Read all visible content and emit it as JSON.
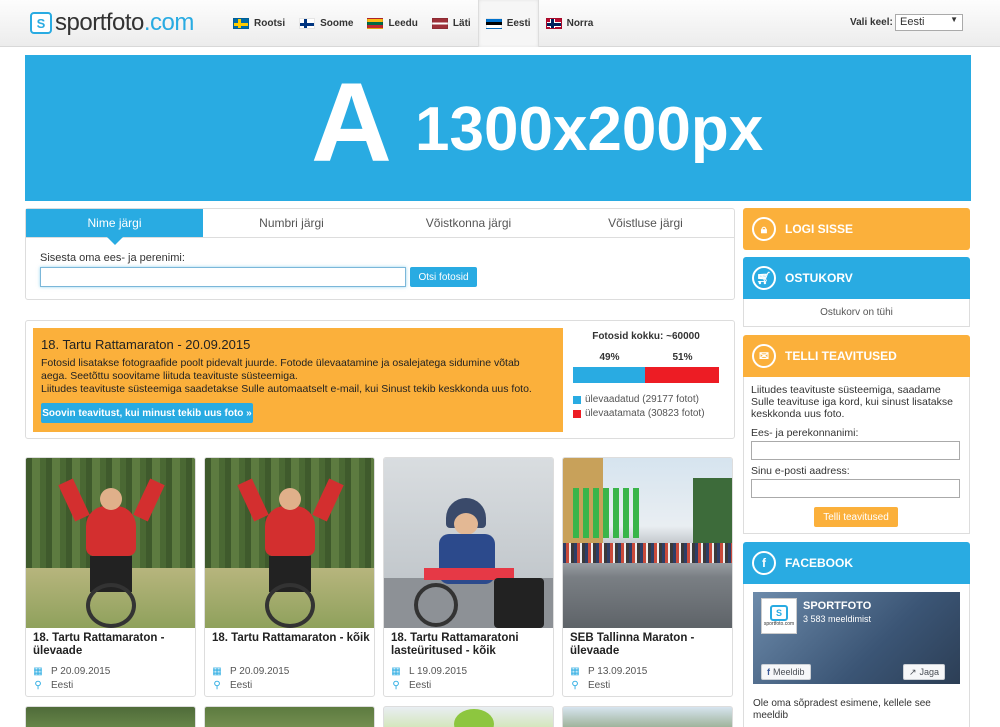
{
  "header": {
    "logo_brand": "sportfoto",
    "logo_tld": ".com",
    "logo_icon_letter": "S",
    "languages": [
      {
        "label": "Rootsi",
        "flag": "sweden-flag"
      },
      {
        "label": "Soome",
        "flag": "finland-flag"
      },
      {
        "label": "Leedu",
        "flag": "lithuania-flag"
      },
      {
        "label": "Läti",
        "flag": "latvia-flag"
      },
      {
        "label": "Eesti",
        "flag": "estonia-flag",
        "active": true
      },
      {
        "label": "Norra",
        "flag": "norway-flag"
      }
    ],
    "language_label": "Vali keel:",
    "language_selected": "Eesti"
  },
  "banner": {
    "letter": "A",
    "size_text": "1300x200px"
  },
  "search": {
    "tabs": [
      "Nime järgi",
      "Numbri järgi",
      "Võistkonna järgi",
      "Võistluse järgi"
    ],
    "active_tab": 0,
    "label": "Sisesta oma ees- ja perenimi:",
    "input_value": "",
    "button": "Otsi fotosid"
  },
  "event": {
    "title": "18. Tartu Rattamaraton - 20.09.2015",
    "description_lines": [
      "Fotosid lisatakse fotograafide poolt pidevalt juurde. Fotode ülevaatamine ja osalejatega sidumine võtab",
      "aega. Seetõttu soovitame liituda teavituste süsteemiga.",
      "Liitudes teavituste süsteemiga saadetakse Sulle automaatselt e-mail, kui Sinust tekib keskkonda uus foto."
    ],
    "button": "Soovin teavitust, kui minust tekib uus foto »",
    "stats": {
      "title": "Fotosid kokku: ~60000",
      "reviewed_pct_label": "49%",
      "unreviewed_pct_label": "51%",
      "reviewed_fraction": 0.49,
      "reviewed_label": "ülevaadatud (29177 fotot)",
      "unreviewed_label": "ülevaatamata (30823 fotot)",
      "reviewed_color": "#29abe2",
      "unreviewed_color": "#ed1c24"
    }
  },
  "cards": [
    {
      "title": "18. Tartu Rattamaraton - ülevaade",
      "date": "P 20.09.2015",
      "location": "Eesti"
    },
    {
      "title": "18. Tartu Rattamaraton - kõik",
      "date": "P 20.09.2015",
      "location": "Eesti"
    },
    {
      "title": "18. Tartu Rattamaratoni lasteüritused - kõik",
      "date": "L 19.09.2015",
      "location": "Eesti"
    },
    {
      "title": "SEB Tallinna Maraton - ülevaade",
      "date": "P 13.09.2015",
      "location": "Eesti"
    }
  ],
  "sidebar": {
    "login": "LOGI SISSE",
    "cart": "OSTUKORV",
    "cart_empty": "Ostukorv on tühi",
    "notify_title": "TELLI TEAVITUSED",
    "notify_desc": "Liitudes teavituste süsteemiga, saadame Sulle teavituse iga kord, kui sinust lisatakse keskkonda uus foto.",
    "name_label": "Ees- ja perekonnanimi:",
    "email_label": "Sinu e-posti aadress:",
    "notify_button": "Telli teavitused",
    "facebook_title": "FACEBOOK",
    "fb_page_name": "SPORTFOTO",
    "fb_likes": "3 583 meeldimist",
    "fb_like_button": "Meeldib",
    "fb_share_button": "Jaga",
    "fb_bottom_text": "Ole oma sõpradest esimene, kellele see meeldib",
    "fb_logo_caption": "sportfoto.com",
    "orange": "#fbb03b",
    "blue": "#29abe2"
  }
}
